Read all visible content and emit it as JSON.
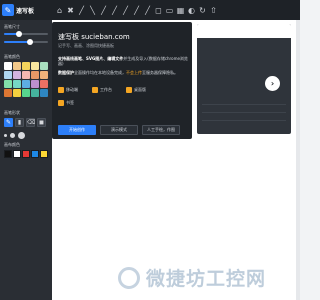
{
  "app": {
    "title": "速写板"
  },
  "toolbar": {
    "tools": [
      "⌂",
      "✖",
      "╱",
      "╲",
      "╱",
      "╱",
      "╱",
      "╱",
      "╱",
      "◻",
      "▭",
      "▦",
      "◐",
      "↻",
      "⇧"
    ]
  },
  "sidebar": {
    "brush_size_title": "画笔尺寸",
    "brush_size_value": 0.35,
    "opacity_value": 0.6,
    "color_title": "画笔颜色",
    "colors": [
      "#ffffff",
      "#f3c98b",
      "#f6d55c",
      "#f9e79f",
      "#a9dfbf",
      "#aed6f1",
      "#d2b4de",
      "#f5b7b1",
      "#e59866",
      "#f0b27a",
      "#82e0aa",
      "#76d7c4",
      "#5dade2",
      "#bb8fce",
      "#ec7063",
      "#dc7633",
      "#f4d03f",
      "#58d68d",
      "#45b39d",
      "#2e86c1"
    ],
    "brush_shape_title": "画笔形状",
    "brush_shapes": [
      "✎",
      "▮",
      "⌫",
      "◼"
    ],
    "bg_title": "画布颜色",
    "bg_colors": [
      "#111111",
      "#ffffff",
      "#e53935",
      "#1e88e5",
      "#fdd835"
    ],
    "brush_size_label_small": "",
    "brush_preview": [
      "",
      "",
      ""
    ]
  },
  "popup": {
    "title": "速写板 sucieban.com",
    "subtitle": "记手写、画画、涂图用快捷画板",
    "line1_bold": "支持画线画笔、SVG图片、编辑文件",
    "line1_rest": "并生成及导入(数据存储chrome浏览器)",
    "line2_bold": "数据保护",
    "line2_rest": "全面操作均在本地设备完成，",
    "line2_hl": "不会上传",
    "line2_end": "至服务器保障隐私。",
    "platforms": [
      "移动端",
      "工作台",
      "桌面版",
      "书签"
    ],
    "buttons": {
      "start": "开始创作",
      "demo": "演示模式",
      "manual": "人工手绘，作图"
    }
  },
  "preview": {
    "next": "›"
  },
  "watermark": {
    "text": "微捷坊工控网"
  }
}
